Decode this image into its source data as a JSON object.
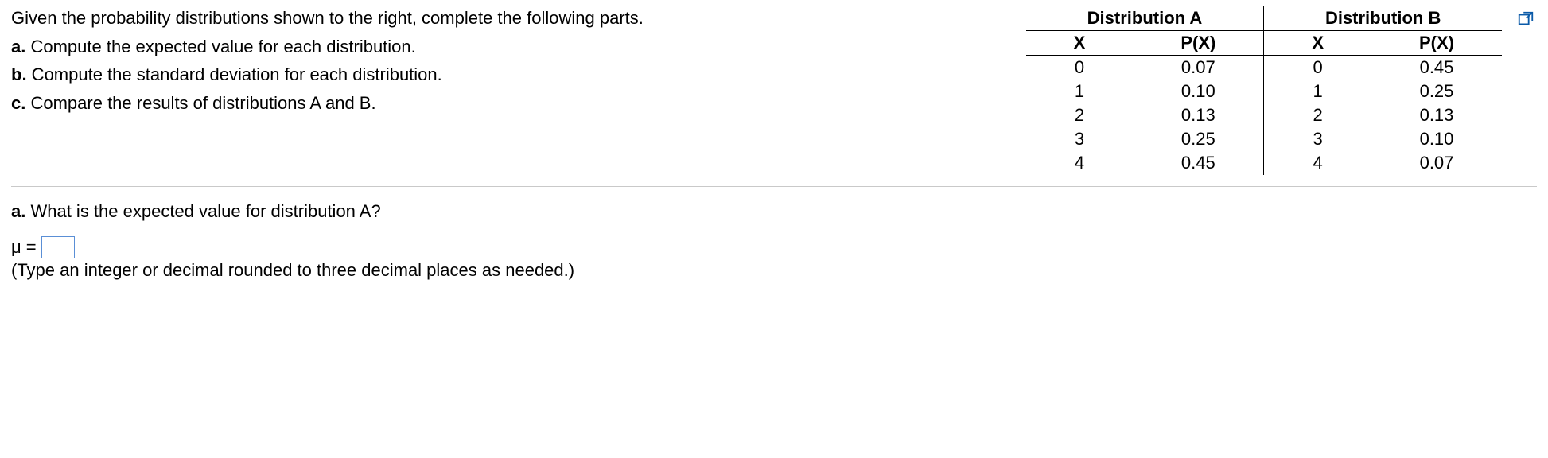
{
  "intro": "Given the probability distributions shown to the right, complete the following parts.",
  "parts": {
    "a_label": "a.",
    "a_text": " Compute the expected value for each distribution.",
    "b_label": "b.",
    "b_text": " Compute the standard deviation for each distribution.",
    "c_label": "c.",
    "c_text": " Compare the results of distributions A and B."
  },
  "table": {
    "dist_a_title": "Distribution A",
    "dist_b_title": "Distribution B",
    "col_x": "X",
    "col_px": "P(X)",
    "rows": [
      {
        "ax": "0",
        "apx": "0.07",
        "bx": "0",
        "bpx": "0.45"
      },
      {
        "ax": "1",
        "apx": "0.10",
        "bx": "1",
        "bpx": "0.25"
      },
      {
        "ax": "2",
        "apx": "0.13",
        "bx": "2",
        "bpx": "0.13"
      },
      {
        "ax": "3",
        "apx": "0.25",
        "bx": "3",
        "bpx": "0.10"
      },
      {
        "ax": "4",
        "apx": "0.45",
        "bx": "4",
        "bpx": "0.07"
      }
    ]
  },
  "question": {
    "a_label": "a.",
    "a_text": " What is the expected value for distribution A?",
    "mu_label": "μ =",
    "hint": "(Type an integer or decimal rounded to three decimal places as needed.)"
  },
  "chart_data": {
    "type": "table",
    "title": "Probability distributions A and B",
    "columns": [
      "X",
      "P_A(X)",
      "P_B(X)"
    ],
    "rows": [
      [
        0,
        0.07,
        0.45
      ],
      [
        1,
        0.1,
        0.25
      ],
      [
        2,
        0.13,
        0.13
      ],
      [
        3,
        0.25,
        0.1
      ],
      [
        4,
        0.45,
        0.07
      ]
    ]
  }
}
